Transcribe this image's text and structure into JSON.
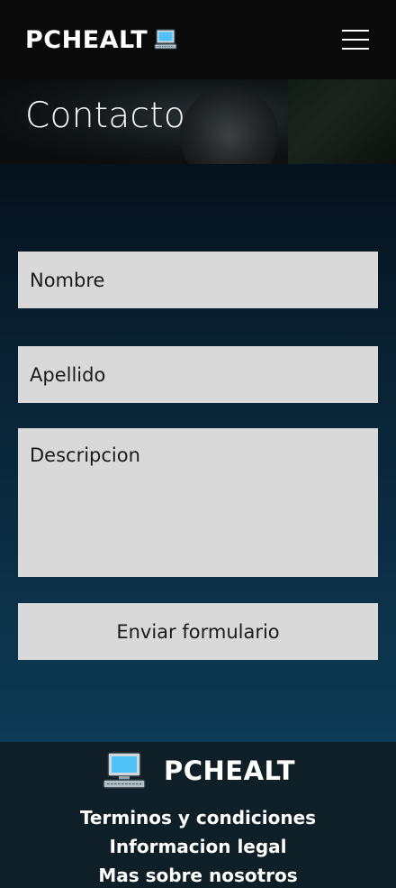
{
  "header": {
    "brand": "PCHEALT",
    "brand_icon": "computer-icon",
    "menu_icon": "hamburger-menu-icon"
  },
  "hero": {
    "title": "Contacto"
  },
  "form": {
    "nombre_placeholder": "Nombre",
    "apellido_placeholder": "Apellido",
    "descripcion_placeholder": "Descripcion",
    "submit_label": "Enviar formulario"
  },
  "footer": {
    "brand": "PCHEALT",
    "brand_icon": "computer-icon",
    "links": [
      {
        "label": "Terminos y condiciones"
      },
      {
        "label": "Informacion legal"
      },
      {
        "label": "Mas sobre nosotros"
      }
    ]
  },
  "colors": {
    "header_bg": "#0a0a0a",
    "field_bg": "#d9d9d9",
    "footer_bg": "#0e1f28",
    "main_gradient_top": "#06121d",
    "main_gradient_bottom": "#0d3a55"
  }
}
